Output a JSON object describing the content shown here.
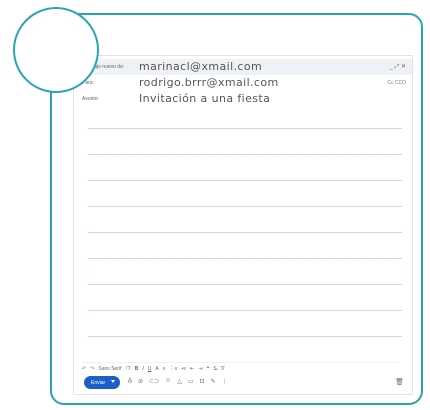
{
  "compose": {
    "header_label": "Mensaje nuevo de:",
    "from": "marinacl@xmail.com",
    "window_controls": "_ ⤢ ✕",
    "to_label": "Para:",
    "to": "rodrigo.brrr@xmail.com",
    "cc_bcc": "Cc CCO",
    "subject_label": "Asunto:",
    "subject": "Invitación a una fiesta"
  },
  "toolbar": {
    "undo": "↶",
    "redo": "↷",
    "font": "Sans Serif",
    "size": "ᵀT",
    "bold": "B",
    "italic": "I",
    "underline": "U",
    "color": "A",
    "align": "≡",
    "numbered": "⋮≡",
    "bulleted": "•≡",
    "indent_less": "⇤",
    "indent_more": "⇥",
    "quote": "❝",
    "strike": "S̶",
    "clear": "T̸"
  },
  "actions": {
    "send_label": "Enviar",
    "format_icon": "A̲",
    "attach_icon": "⊘",
    "link_icon": "⊂⊃",
    "emoji_icon": "☺",
    "drive_icon": "△",
    "photo_icon": "▭",
    "lock_icon": "⊡",
    "sign_icon": "✎",
    "more_icon": "⋮",
    "trash_icon": "🗑"
  }
}
